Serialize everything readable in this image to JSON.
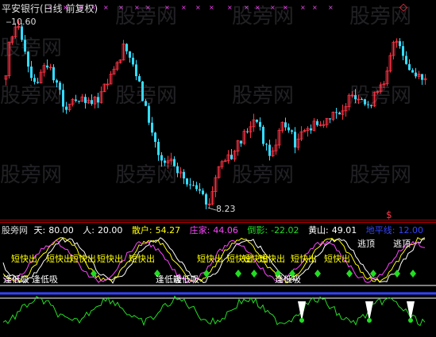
{
  "window": {
    "title": "平安银行(日线 前复权)",
    "corner_icon": "diamond-icon"
  },
  "price_pane": {
    "high_label": "10.60",
    "low_label": "8.23",
    "marker_char": "$",
    "top_marks": "× × × × × × × × × × × ×"
  },
  "watermark": "股旁网",
  "indicator": {
    "name": "股旁网",
    "values": [
      {
        "label": "天:",
        "value": "80.00",
        "color": "#ffffff"
      },
      {
        "label": "人:",
        "value": "20.00",
        "color": "#ffffff"
      },
      {
        "label": "散户:",
        "value": "54.27",
        "color": "#ffff00"
      },
      {
        "label": "庄家:",
        "value": "44.06",
        "color": "#ff44ff"
      },
      {
        "label": "倒影:",
        "value": "-22.02",
        "color": "#22dd22"
      },
      {
        "label": "黄山:",
        "value": "49.01",
        "color": "#ffffff"
      },
      {
        "label": "地平线:",
        "value": "12.00",
        "color": "#3344ff"
      }
    ],
    "signals": {
      "short_sell": "短快出",
      "buy_low": "逢低吸",
      "escape_top": "逃顶"
    }
  },
  "colors": {
    "up": "#ff3344",
    "down": "#33ddff",
    "magenta": "#ff44ff",
    "yellow": "#ffff00",
    "green": "#22dd22",
    "blue": "#3344ff"
  }
}
